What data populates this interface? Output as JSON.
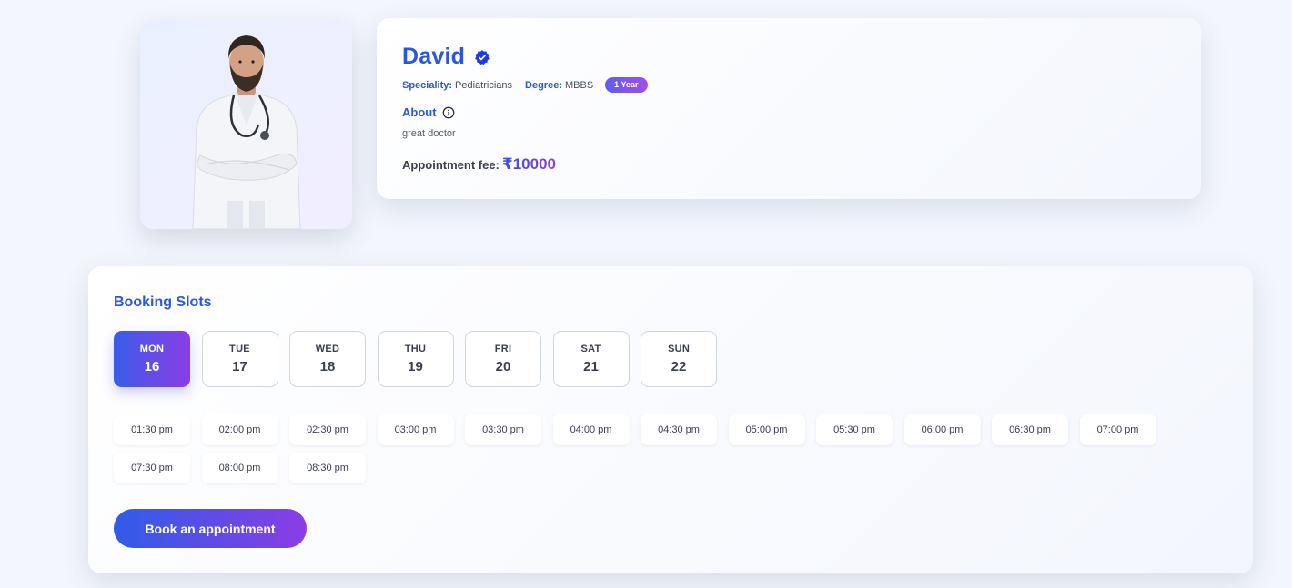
{
  "doctor": {
    "name": "David",
    "speciality_label": "Speciality:",
    "speciality": "Pediatricians",
    "degree_label": "Degree:",
    "degree": "MBBS",
    "experience": "1 Year",
    "about_label": "About",
    "about_text": "great doctor",
    "fee_label": "Appointment fee:",
    "fee_value": "₹10000",
    "photo_icon": "doctor-portrait",
    "verified_icon": "verified-badge-icon",
    "info_icon": "info-circle-icon"
  },
  "booking": {
    "title": "Booking Slots",
    "days": [
      {
        "name": "MON",
        "date": "16",
        "selected": true
      },
      {
        "name": "TUE",
        "date": "17",
        "selected": false
      },
      {
        "name": "WED",
        "date": "18",
        "selected": false
      },
      {
        "name": "THU",
        "date": "19",
        "selected": false
      },
      {
        "name": "FRI",
        "date": "20",
        "selected": false
      },
      {
        "name": "SAT",
        "date": "21",
        "selected": false
      },
      {
        "name": "SUN",
        "date": "22",
        "selected": false
      }
    ],
    "times": [
      "01:30 pm",
      "02:00 pm",
      "02:30 pm",
      "03:00 pm",
      "03:30 pm",
      "04:00 pm",
      "04:30 pm",
      "05:00 pm",
      "05:30 pm",
      "06:00 pm",
      "06:30 pm",
      "07:00 pm",
      "07:30 pm",
      "08:00 pm",
      "08:30 pm"
    ],
    "book_button": "Book an appointment"
  },
  "colors": {
    "accent_blue": "#2a57dd",
    "gradient_start": "#3a5de8",
    "gradient_end": "#8a3de6",
    "page_bg": "#f3f6fc"
  }
}
